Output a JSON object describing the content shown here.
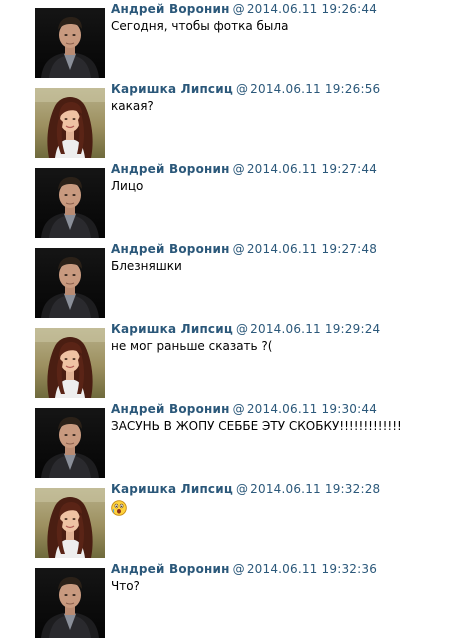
{
  "colors": {
    "author": "#2b587a",
    "timestamp": "#2b587a",
    "text": "#000000"
  },
  "messages": [
    {
      "author": "Андрей Воронин",
      "at": "@",
      "timestamp": "2014.06.11 19:26:44",
      "text": "Сегодня, чтобы фотка была",
      "avatar": "man-dark-jacket"
    },
    {
      "author": "Каришка Липсиц",
      "at": "@",
      "timestamp": "2014.06.11 19:26:56",
      "text": "какая?",
      "avatar": "girl-brown-hair"
    },
    {
      "author": "Андрей Воронин",
      "at": "@",
      "timestamp": "2014.06.11 19:27:44",
      "text": "Лицо",
      "avatar": "man-dark-jacket"
    },
    {
      "author": "Андрей Воронин",
      "at": "@",
      "timestamp": "2014.06.11 19:27:48",
      "text": "Блезняшки",
      "avatar": "man-dark-jacket"
    },
    {
      "author": "Каришка Липсиц",
      "at": "@",
      "timestamp": "2014.06.11 19:29:24",
      "text": "не мог раньше сказать ?(",
      "avatar": "girl-brown-hair"
    },
    {
      "author": "Андрей Воронин",
      "at": "@",
      "timestamp": "2014.06.11 19:30:44",
      "text": "ЗАСУНЬ В ЖОПУ СЕББЕ ЭТУ СКОБКУ!!!!!!!!!!!!!",
      "avatar": "man-dark-jacket"
    },
    {
      "author": "Каришка Липсиц",
      "at": "@",
      "timestamp": "2014.06.11 19:32:28",
      "text": "",
      "emoji": "shocked-emoji-icon",
      "avatar": "girl-brown-hair"
    },
    {
      "author": "Андрей Воронин",
      "at": "@",
      "timestamp": "2014.06.11 19:32:36",
      "text": "Что?",
      "avatar": "man-dark-jacket"
    }
  ]
}
